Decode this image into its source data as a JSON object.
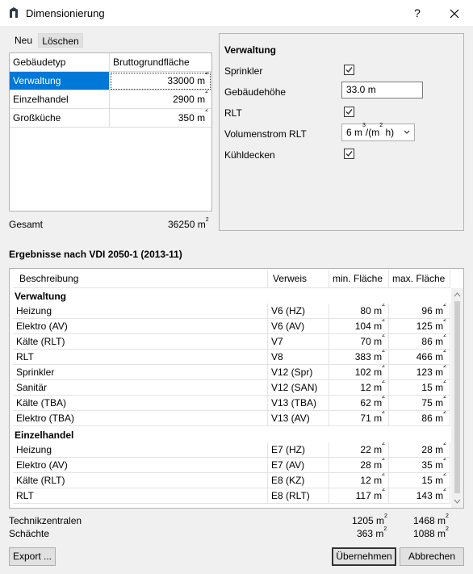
{
  "window": {
    "title": "Dimensionierung",
    "help": "?",
    "close": "✕"
  },
  "toolbar": {
    "new_label": "Neu",
    "delete_label": "Löschen"
  },
  "buildings_table": {
    "col_type": "Gebäudetyp",
    "col_area": "Bruttogrundfläche",
    "rows": [
      {
        "type": "Verwaltung",
        "area": "33000 m",
        "selected": true
      },
      {
        "type": "Einzelhandel",
        "area": "2900 m",
        "selected": false
      },
      {
        "type": "Großküche",
        "area": "350 m",
        "selected": false
      }
    ]
  },
  "total": {
    "label": "Gesamt",
    "value": "36250 m"
  },
  "sup2": "2",
  "details": {
    "title": "Verwaltung",
    "sprinkler_label": "Sprinkler",
    "sprinkler_checked": true,
    "height_label": "Gebäudehöhe",
    "height_value": "33.0 m",
    "rlt_label": "RLT",
    "rlt_checked": true,
    "flow_label": "Volumenstrom RLT",
    "flow_value_a": "6 m",
    "flow_value_b": "/(m",
    "flow_value_c": " h)",
    "sup3": "3",
    "cooling_label": "Kühldecken",
    "cooling_checked": true
  },
  "results": {
    "title": "Ergebnisse nach VDI 2050-1 (2013-11)",
    "columns": {
      "desc": "Beschreibung",
      "ref": "Verweis",
      "min": "min. Fläche",
      "max": "max. Fläche"
    },
    "groups": [
      {
        "name": "Verwaltung",
        "rows": [
          {
            "desc": "Heizung",
            "ref": "V6 (HZ)",
            "min": "80 m",
            "max": "96 m"
          },
          {
            "desc": "Elektro (AV)",
            "ref": "V6 (AV)",
            "min": "104 m",
            "max": "125 m"
          },
          {
            "desc": "Kälte (RLT)",
            "ref": "V7",
            "min": "70 m",
            "max": "86 m"
          },
          {
            "desc": "RLT",
            "ref": "V8",
            "min": "383 m",
            "max": "466 m"
          },
          {
            "desc": "Sprinkler",
            "ref": "V12 (Spr)",
            "min": "102 m",
            "max": "123 m"
          },
          {
            "desc": "Sanitär",
            "ref": "V12 (SAN)",
            "min": "12 m",
            "max": "15 m"
          },
          {
            "desc": "Kälte (TBA)",
            "ref": "V13 (TBA)",
            "min": "62 m",
            "max": "75 m"
          },
          {
            "desc": "Elektro (TBA)",
            "ref": "V13 (AV)",
            "min": "71 m",
            "max": "86 m"
          }
        ]
      },
      {
        "name": "Einzelhandel",
        "rows": [
          {
            "desc": "Heizung",
            "ref": "E7 (HZ)",
            "min": "22 m",
            "max": "28 m"
          },
          {
            "desc": "Elektro (AV)",
            "ref": "E7 (AV)",
            "min": "28 m",
            "max": "35 m"
          },
          {
            "desc": "Kälte (RLT)",
            "ref": "E8 (KZ)",
            "min": "12 m",
            "max": "15 m"
          },
          {
            "desc": "RLT",
            "ref": "E8 (RLT)",
            "min": "117 m",
            "max": "143 m"
          }
        ]
      }
    ]
  },
  "summary": {
    "tech_label": "Technikzentralen",
    "tech_min": "1205 m",
    "tech_max": "1468 m",
    "shaft_label": "Schächte",
    "shaft_min": "363 m",
    "shaft_max": "1088 m"
  },
  "buttons": {
    "export": "Export ...",
    "apply": "Übernehmen",
    "cancel": "Abbrechen"
  },
  "icons": {
    "app": "app-logo-icon",
    "check": "check-icon",
    "dropdown": "chevron-down-icon",
    "scroll_up": "scroll-up-icon",
    "scroll_down": "scroll-down-icon"
  },
  "colors": {
    "selection": "#0078d7",
    "check": "#333333"
  }
}
